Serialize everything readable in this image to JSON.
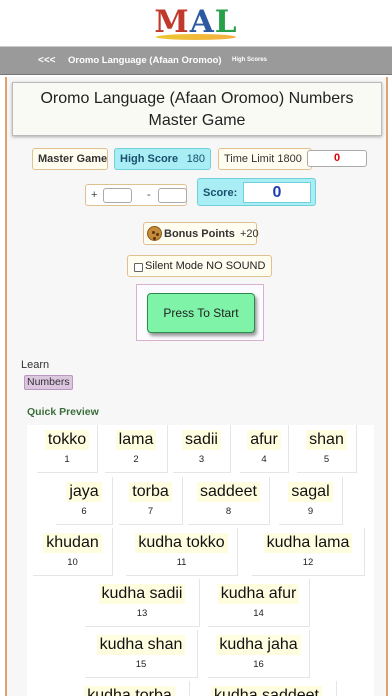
{
  "logo": {
    "m": "M",
    "a": "A",
    "l": "L"
  },
  "nav": {
    "back": "<<<",
    "title": "Oromo Language (Afaan Oromoo)",
    "high_scores": "High Scores"
  },
  "title": {
    "line1": "Oromo Language (Afaan Oromoo) Numbers",
    "line2": "Master Game"
  },
  "stats": {
    "master_game": "Master Game",
    "high_score_label": "High Score",
    "high_score_value": "180",
    "time_limit_label": "Time Limit 1800",
    "time_value": "0",
    "plus": "+",
    "minus": "-",
    "score_label": "Score:",
    "score_value": "0"
  },
  "bonus": {
    "label": "Bonus Points",
    "value": "+20"
  },
  "silent": {
    "label": "Silent Mode NO SOUND",
    "checked": false
  },
  "start": {
    "label": "Press To Start"
  },
  "learn": {
    "label": "Learn",
    "chip": "Numbers"
  },
  "preview": {
    "label": "Quick Preview",
    "items": [
      {
        "word": "tokko",
        "num": "1"
      },
      {
        "word": "lama",
        "num": "2"
      },
      {
        "word": "sadii",
        "num": "3"
      },
      {
        "word": "afur",
        "num": "4"
      },
      {
        "word": "shan",
        "num": "5"
      },
      {
        "word": "jaya",
        "num": "6"
      },
      {
        "word": "torba",
        "num": "7"
      },
      {
        "word": "saddeet",
        "num": "8"
      },
      {
        "word": "sagal",
        "num": "9"
      },
      {
        "word": "khudan",
        "num": "10"
      },
      {
        "word": "kudha tokko",
        "num": "11"
      },
      {
        "word": "kudha lama",
        "num": "12"
      },
      {
        "word": "kudha sadii",
        "num": "13"
      },
      {
        "word": "kudha afur",
        "num": "14"
      },
      {
        "word": "kudha shan",
        "num": "15"
      },
      {
        "word": "kudha jaha",
        "num": "16"
      },
      {
        "word": "kudha torba",
        "num": ""
      },
      {
        "word": "kudha saddeet",
        "num": ""
      }
    ]
  }
}
